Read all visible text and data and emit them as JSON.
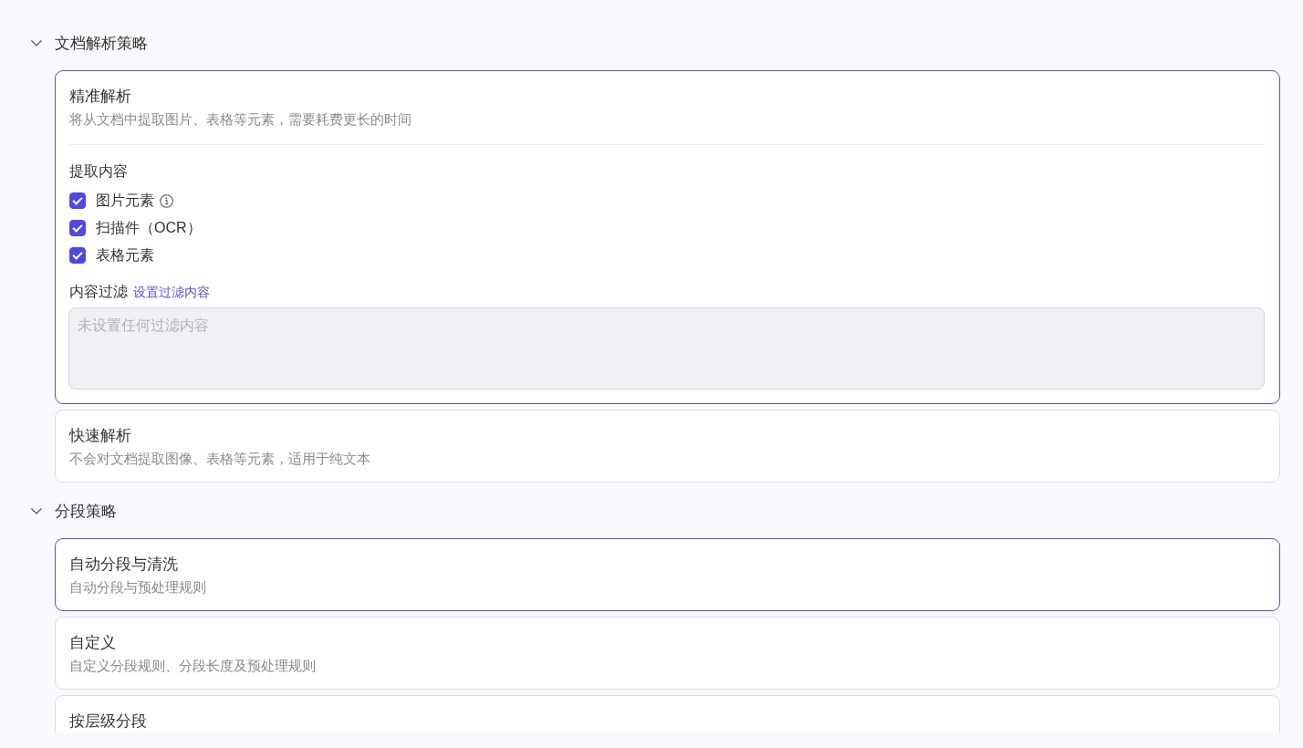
{
  "sections": [
    {
      "title": "文档解析策略",
      "expanded": true,
      "options": [
        {
          "title": "精准解析",
          "description": "将从文档中提取图片、表格等元素，需要耗费更长的时间",
          "selected": true,
          "details": {
            "heading": "提取内容",
            "checkboxes": [
              {
                "label": "图片元素",
                "checked": true,
                "info": true
              },
              {
                "label": "扫描件（OCR）",
                "checked": true,
                "info": false
              },
              {
                "label": "表格元素",
                "checked": true,
                "info": false
              }
            ],
            "filter": {
              "label": "内容过滤",
              "link": "设置过滤内容",
              "field": {
                "placeholder": "未设置任何过滤内容"
              }
            }
          }
        },
        {
          "title": "快速解析",
          "description": "不会对文档提取图像、表格等元素，适用于纯文本",
          "selected": false
        }
      ]
    },
    {
      "title": "分段策略",
      "expanded": true,
      "options": [
        {
          "title": "自动分段与清洗",
          "description": "自动分段与预处理规则",
          "selected": true
        },
        {
          "title": "自定义",
          "description": "自定义分段规则、分段长度及预处理规则",
          "selected": false
        },
        {
          "title": "按层级分段",
          "selected": false
        }
      ]
    }
  ]
}
